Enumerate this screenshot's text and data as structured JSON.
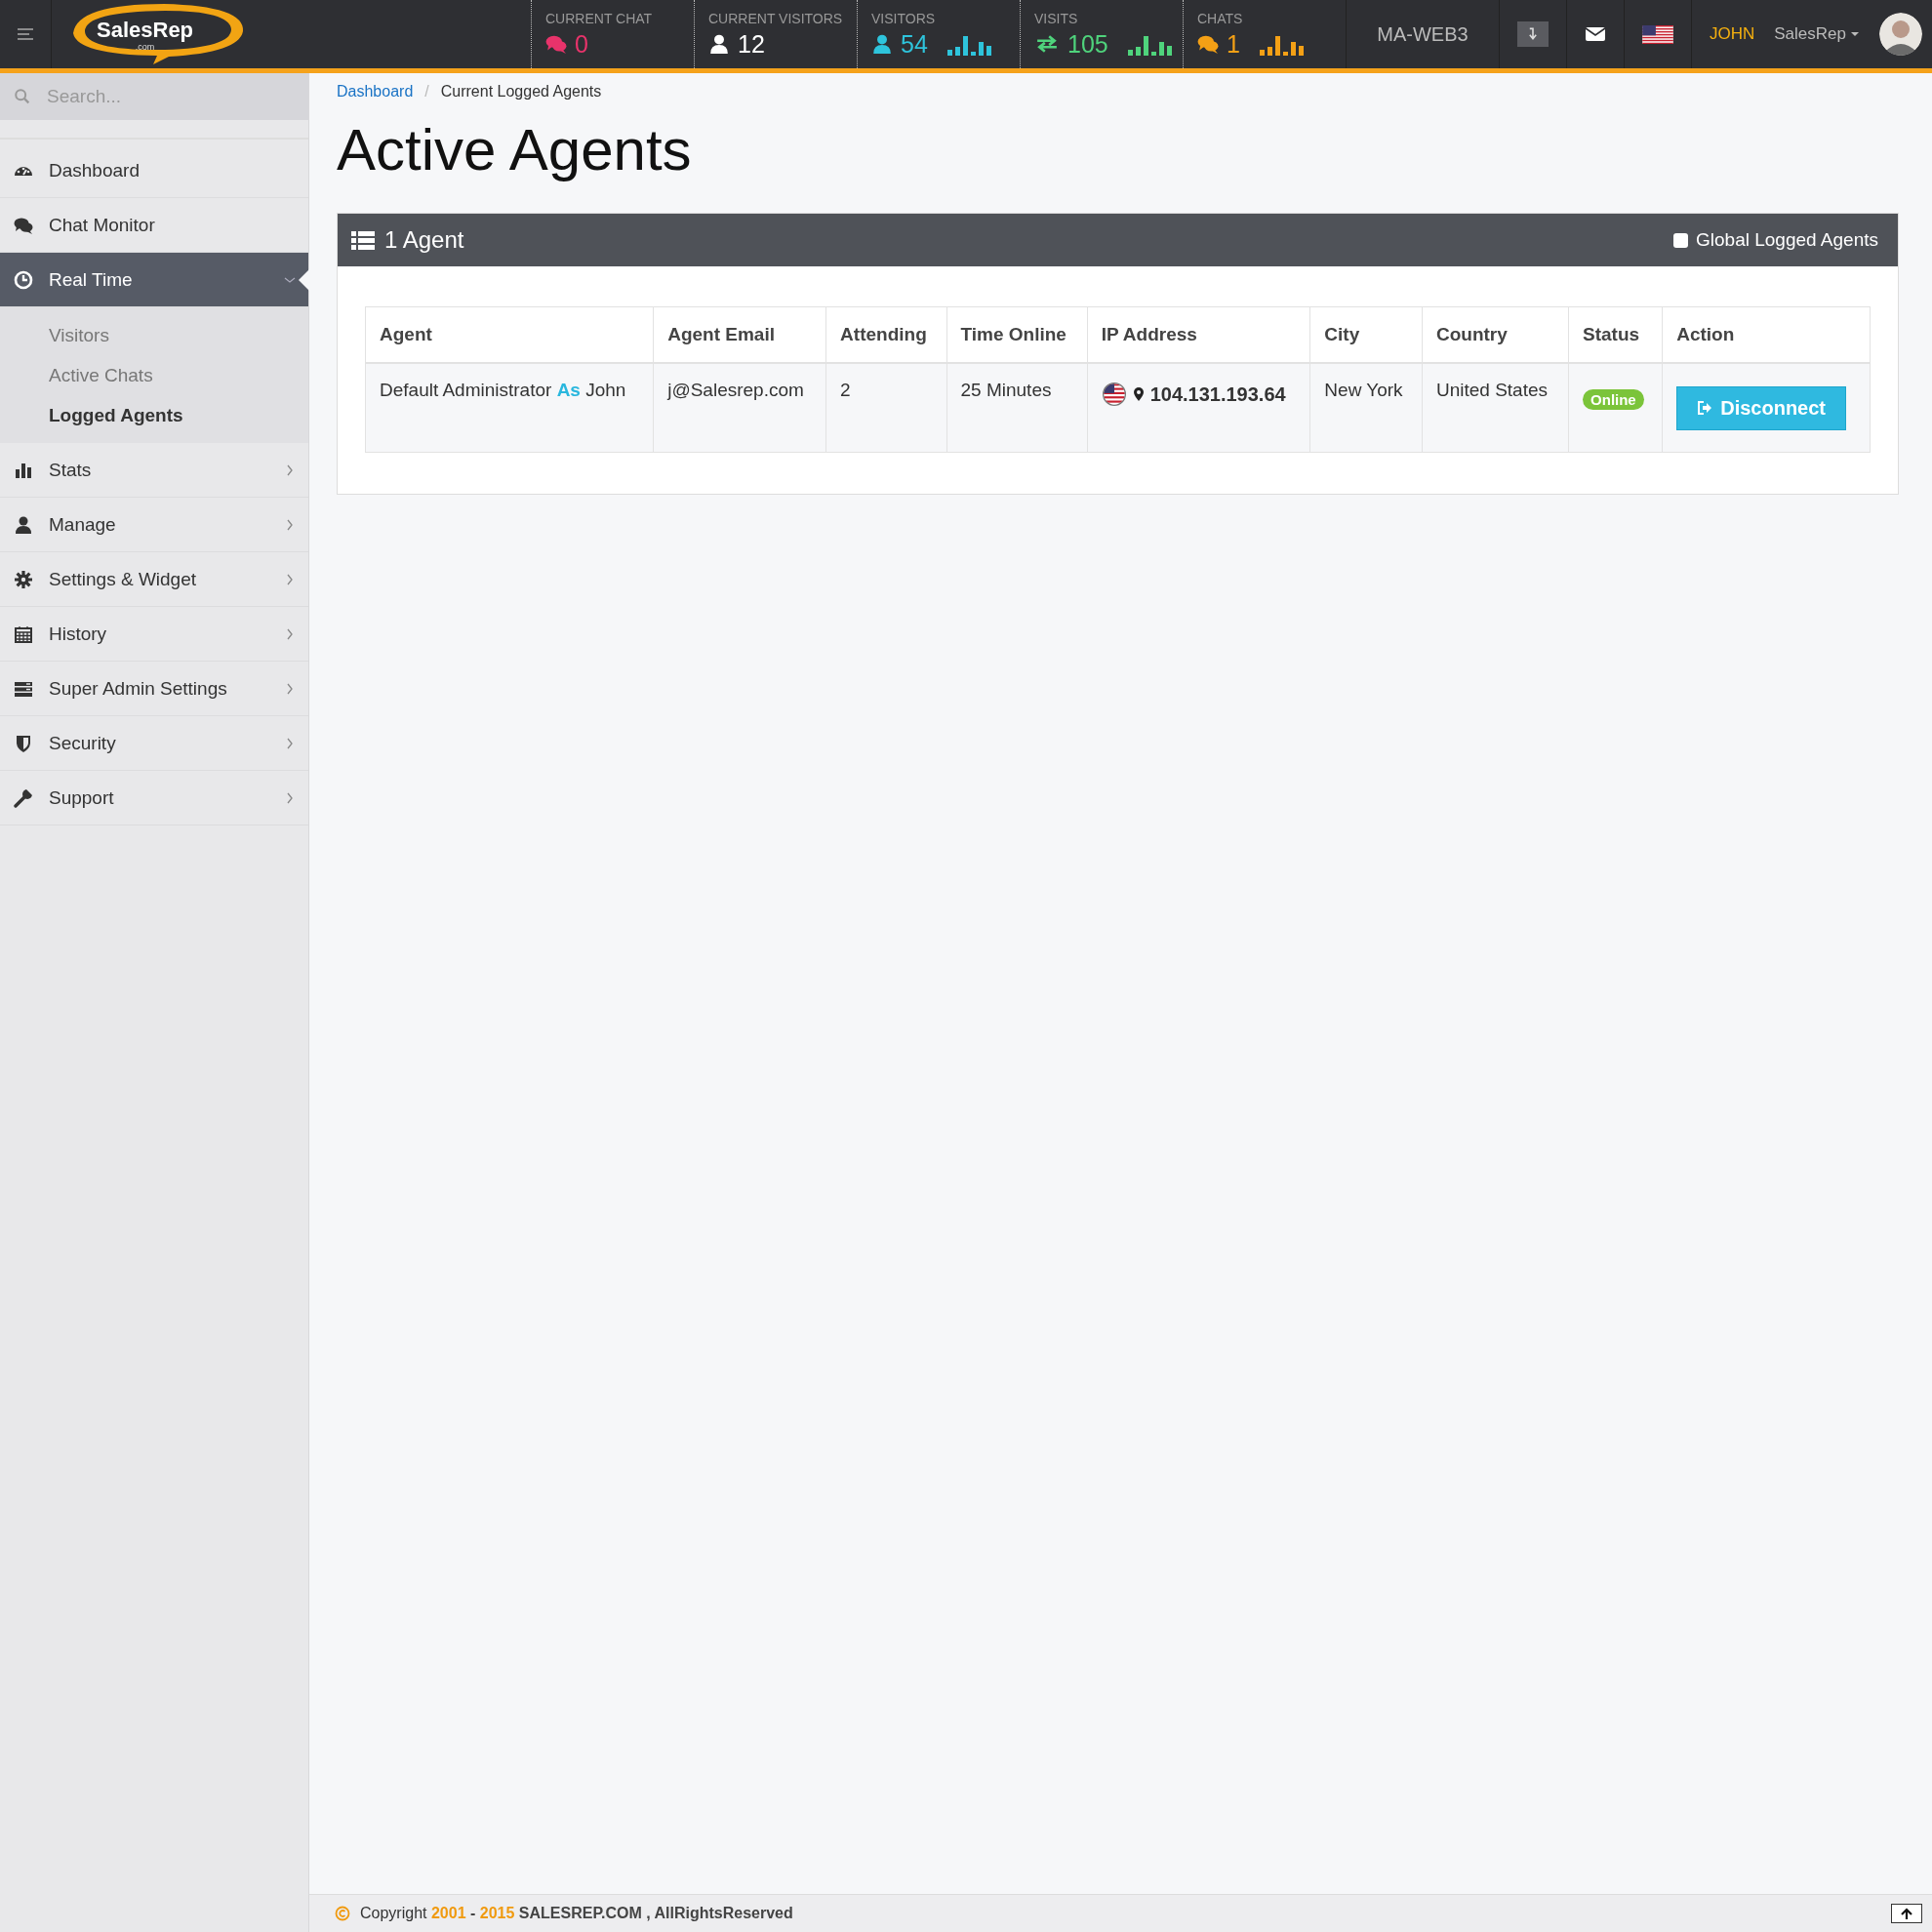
{
  "topbar": {
    "brand": "SalesRep",
    "brand_sub": ".com",
    "stats": [
      {
        "label": "CURRENT CHAT",
        "value": "0",
        "kind": "chat",
        "color": "#e8336b",
        "bars": false
      },
      {
        "label": "CURRENT VISITORS",
        "value": "12",
        "kind": "user",
        "color": "#ffffff",
        "bars": false
      },
      {
        "label": "VISITORS",
        "value": "54",
        "kind": "user",
        "color": "#2ec4dc",
        "bars": true
      },
      {
        "label": "VISITS",
        "value": "105",
        "kind": "exchange",
        "color": "#4fd37c",
        "bars": true
      },
      {
        "label": "CHATS",
        "value": "1",
        "kind": "chat",
        "color": "#f4a015",
        "bars": true
      }
    ],
    "server": "MA-WEB3",
    "user": "JOHN",
    "role": "SalesRep"
  },
  "sidebar": {
    "search": {
      "placeholder": "Search..."
    },
    "items": [
      {
        "label": "Dashboard",
        "kind": "dashboard",
        "selected": false
      },
      {
        "label": "Chat Monitor",
        "kind": "chat",
        "selected": false
      },
      {
        "label": "Real Time",
        "kind": "clock",
        "selected": true,
        "expanded": true,
        "children": [
          {
            "label": "Visitors",
            "selected": false
          },
          {
            "label": "Active Chats",
            "selected": false
          },
          {
            "label": "Logged Agents",
            "selected": true
          }
        ]
      },
      {
        "label": "Stats",
        "kind": "stats",
        "selected": false,
        "expanded": false
      },
      {
        "label": "Manage",
        "kind": "user",
        "selected": false,
        "expanded": false
      },
      {
        "label": "Settings & Widget",
        "kind": "gear",
        "selected": false,
        "expanded": false
      },
      {
        "label": "History",
        "kind": "calendar",
        "selected": false,
        "expanded": false
      },
      {
        "label": "Super Admin Settings",
        "kind": "server",
        "selected": false,
        "expanded": false
      },
      {
        "label": "Security",
        "kind": "shield",
        "selected": false,
        "expanded": false
      },
      {
        "label": "Support",
        "kind": "wrench",
        "selected": false,
        "expanded": false
      }
    ]
  },
  "breadcrumb": {
    "separator": "/",
    "items": [
      {
        "label": "Dashboard",
        "kind": "link"
      },
      {
        "label": "Current Logged Agents",
        "kind": "current"
      }
    ]
  },
  "title": "Active Agents",
  "panel": {
    "title": "1 Agent",
    "toggle": {
      "label": "Global Logged Agents",
      "checked": false
    },
    "table": {
      "columns": [
        "Agent",
        "Agent Email",
        "Attending",
        "Time Online",
        "IP Address",
        "City",
        "Country",
        "Status",
        "Action"
      ],
      "rows": [
        {
          "agent": {
            "name": "Default Administrator",
            "as": "As",
            "user": "John"
          },
          "email": "j@Salesrep.com",
          "attending": "2",
          "time_online": "25 Minutes",
          "ip": "104.131.193.64",
          "city": "New York",
          "country": "United States",
          "status": {
            "text": "Online",
            "kind": "online"
          },
          "action": "Disconnect"
        }
      ]
    }
  },
  "footer": {
    "parts": [
      {
        "text": "Copyright",
        "kind": "plain"
      },
      {
        "text": "2001",
        "kind": "year"
      },
      {
        "text": "-",
        "kind": "bold"
      },
      {
        "text": "2015",
        "kind": "year"
      },
      {
        "text": "SALESREP.COM , AllRightsReserved",
        "kind": "bold"
      }
    ]
  }
}
